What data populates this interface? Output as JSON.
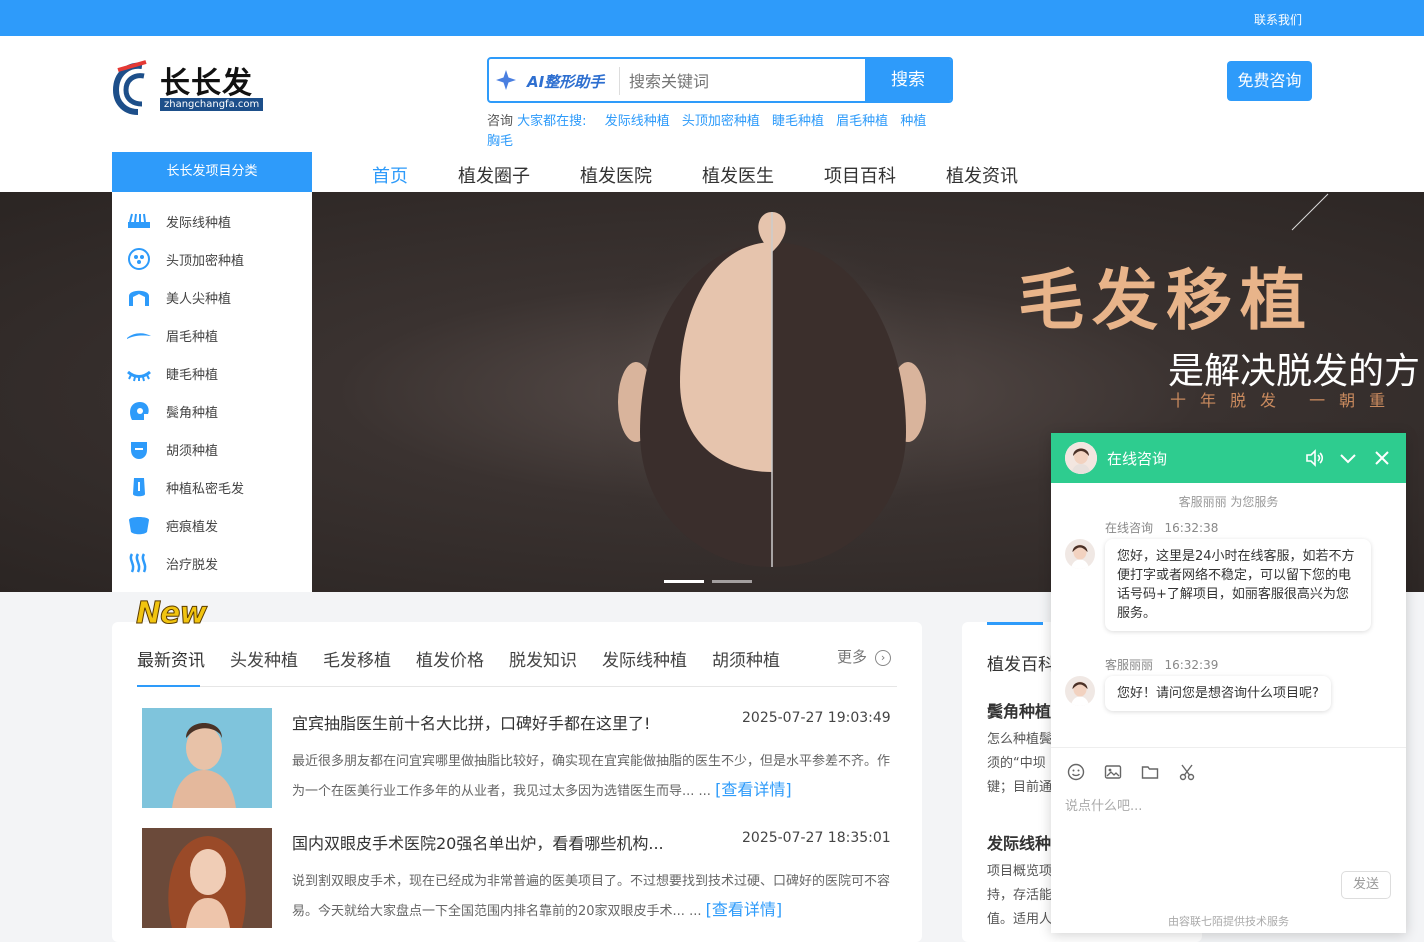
{
  "topbar": {
    "contact": "联系我们"
  },
  "logo": {
    "name": "长长发",
    "domain": "zhangchangfa.com"
  },
  "search": {
    "ai_label": "AI整形助手",
    "placeholder": "搜索关键词",
    "button": "搜索"
  },
  "hot_searches": {
    "label": "咨询",
    "lead": "大家都在搜:",
    "items": [
      "发际线种植",
      "头顶加密种植",
      "睫毛种植",
      "眉毛种植",
      "种植胸毛"
    ]
  },
  "consult_button": "免费咨询",
  "category_header": "长长发项目分类",
  "nav": [
    "首页",
    "植发圈子",
    "植发医院",
    "植发医生",
    "项目百科",
    "植发资讯"
  ],
  "categories": [
    {
      "label": "发际线种植",
      "icon": "hairline-icon"
    },
    {
      "label": "头顶加密种植",
      "icon": "crown-density-icon"
    },
    {
      "label": "美人尖种植",
      "icon": "widows-peak-icon"
    },
    {
      "label": "眉毛种植",
      "icon": "eyebrow-icon"
    },
    {
      "label": "睫毛种植",
      "icon": "eyelash-icon"
    },
    {
      "label": "鬓角种植",
      "icon": "sideburn-icon"
    },
    {
      "label": "胡须种植",
      "icon": "beard-icon"
    },
    {
      "label": "种植私密毛发",
      "icon": "private-hair-icon"
    },
    {
      "label": "疤痕植发",
      "icon": "scar-icon"
    },
    {
      "label": "治疗脱发",
      "icon": "hair-loss-icon"
    }
  ],
  "banner": {
    "title": "毛发移植",
    "subtitle": "是解决脱发的方",
    "tagline": "十年脱发  一朝重"
  },
  "news": {
    "badge": "New",
    "tabs": [
      "最新资讯",
      "头发种植",
      "毛发移植",
      "植发价格",
      "脱发知识",
      "发际线种植",
      "胡须种植"
    ],
    "more": "更多",
    "articles": [
      {
        "title": "宜宾抽脂医生前十名大比拼，口碑好手都在这里了!",
        "date": "2025-07-27 19:03:49",
        "desc": "最近很多朋友都在问宜宾哪里做抽脂比较好，确实现在宜宾能做抽脂的医生不少，但是水平参差不齐。作为一个在医美行业工作多年的从业者，我见过太多因为选错医生而导... ...",
        "detail": "[查看详情]"
      },
      {
        "title": "国内双眼皮手术医院20强名单出炉，看看哪些机构...",
        "date": "2025-07-27 18:35:01",
        "desc": "说到割双眼皮手术，现在已经成为非常普遍的医美项目了。不过想要找到技术过硬、口碑好的医院可不容易。今天就给大家盘点一下全国范围内排名靠前的20家双眼皮手术... ...",
        "detail": "[查看详情]"
      }
    ]
  },
  "encyclopedia": {
    "heading": "植发百科",
    "item1_title": "鬓角种植",
    "item1_lines": [
      "怎么种植鬓",
      "须的“中坝",
      "键；目前通"
    ],
    "item2_title": "发际线种",
    "item2_lines": [
      "项目概览项",
      "持，存活能",
      "值。适用人"
    ]
  },
  "chat": {
    "title": "在线咨询",
    "service_note": "客服丽丽 为您服务",
    "messages": [
      {
        "sender": "在线咨询",
        "time": "16:32:38",
        "text": "您好，这里是24小时在线客服，如若不方便打字或者网络不稳定，可以留下您的电话号码+了解项目，如丽客服很高兴为您服务。"
      },
      {
        "sender": "客服丽丽",
        "time": "16:32:39",
        "text": "您好！请问您是想咨询什么项目呢?"
      }
    ],
    "input_placeholder": "说点什么吧...",
    "send": "发送",
    "footer": "由容联七陌提供技术服务"
  },
  "colors": {
    "brand": "#2e9bfa",
    "chat_header": "#2ecc8f",
    "banner_title": "#e8b48a"
  }
}
